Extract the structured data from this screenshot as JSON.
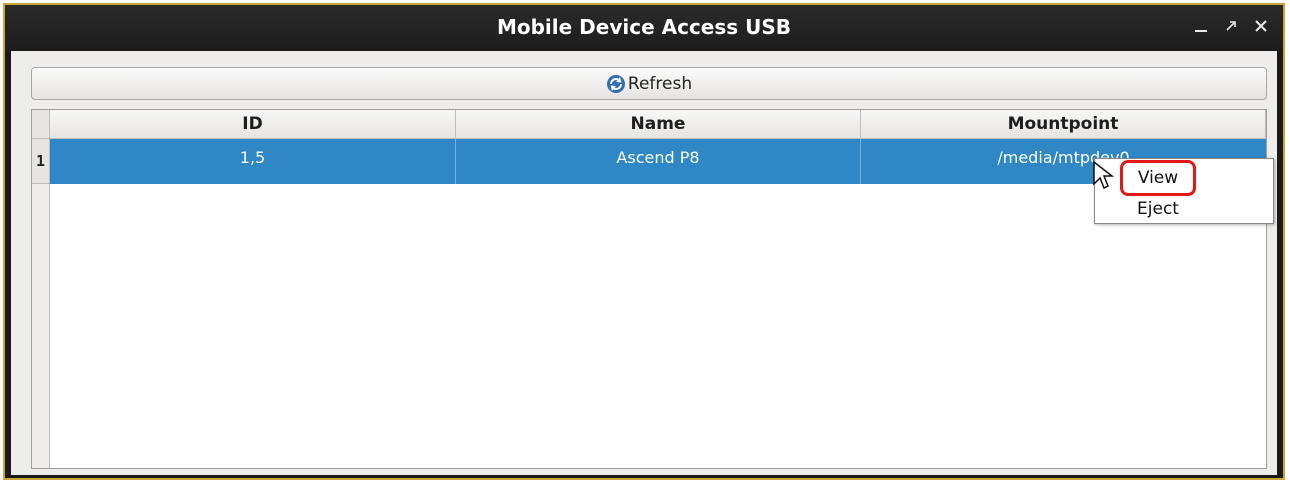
{
  "window": {
    "title": "Mobile Device Access USB",
    "controls": [
      "minimize-icon",
      "maximize-icon",
      "close-icon"
    ]
  },
  "toolbar": {
    "refresh_label": "Refresh",
    "refresh_icon": "refresh-icon"
  },
  "table": {
    "columns": [
      "ID",
      "Name",
      "Mountpoint"
    ],
    "rows": [
      {
        "num": "1",
        "id": "1,5",
        "name": "Ascend P8",
        "mountpoint": "/media/mtpdev0",
        "selected": true
      }
    ]
  },
  "context_menu": {
    "items": [
      {
        "label": "View",
        "highlighted": true
      },
      {
        "label": "Eject",
        "highlighted": false
      }
    ]
  },
  "colors": {
    "selection": "#2f87c5",
    "titlebar": "#1c1c1c",
    "window_border": "#c9a53a",
    "highlight_box": "#e01818"
  }
}
